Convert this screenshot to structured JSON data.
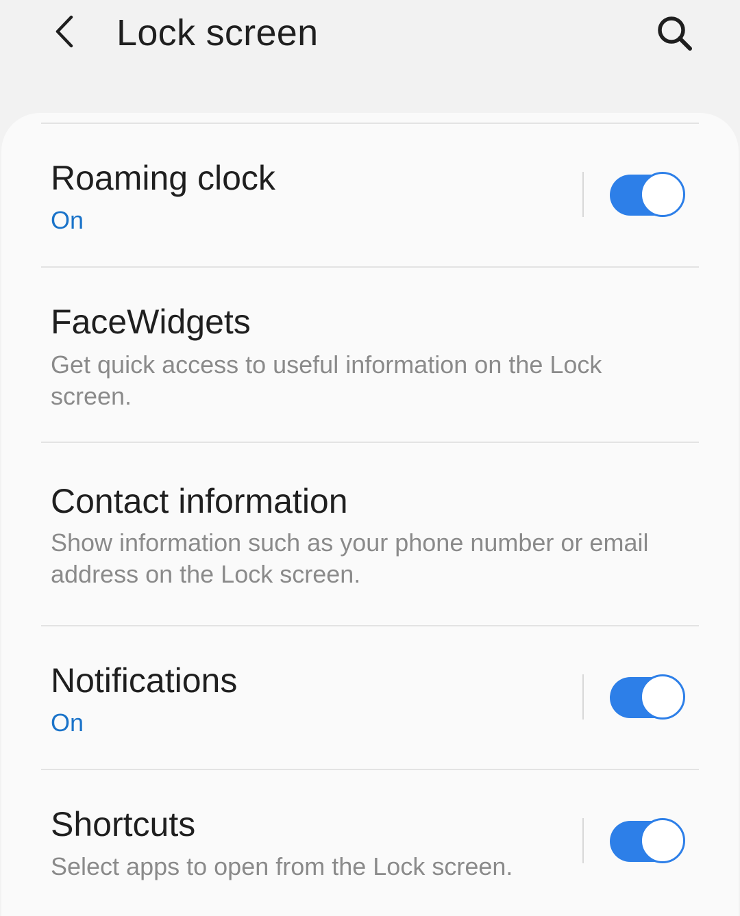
{
  "header": {
    "title": "Lock screen",
    "back_icon": "chevron-left-icon",
    "search_icon": "search-icon"
  },
  "colors": {
    "accent": "#2d7fe8",
    "status_text": "#1a73c9",
    "background": "#f2f2f2",
    "card": "#fafafa"
  },
  "settings": [
    {
      "title": "Roaming clock",
      "status": "On",
      "toggle": true
    },
    {
      "title": "FaceWidgets",
      "description": "Get quick access to useful information on the Lock screen."
    },
    {
      "title": "Contact information",
      "description": "Show information such as your phone number or email address on the Lock screen."
    },
    {
      "title": "Notifications",
      "status": "On",
      "toggle": true
    },
    {
      "title": "Shortcuts",
      "description": "Select apps to open from the Lock screen.",
      "toggle": true
    }
  ]
}
